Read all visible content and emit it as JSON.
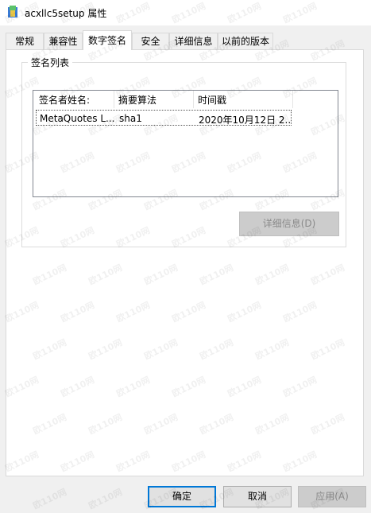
{
  "window": {
    "title": "acxllc5setup 属性"
  },
  "tabs": [
    {
      "label": "常规"
    },
    {
      "label": "兼容性"
    },
    {
      "label": "数字签名",
      "active": true
    },
    {
      "label": "安全"
    },
    {
      "label": "详细信息"
    },
    {
      "label": "以前的版本"
    }
  ],
  "signature_group": {
    "label": "签名列表",
    "columns": [
      "签名者姓名:",
      "摘要算法",
      "时间戳"
    ],
    "rows": [
      {
        "name": "MetaQuotes L...",
        "algorithm": "sha1",
        "timestamp": "2020年10月12日 2..."
      }
    ],
    "details_button": "详细信息(D)"
  },
  "footer": {
    "ok_button": "确定",
    "cancel_button": "取消",
    "apply_button": "应用(A)"
  },
  "watermark": {
    "text": "欧110网"
  },
  "colors": {
    "accent": "#0078d7",
    "window_bg": "#f0f0f0",
    "panel_bg": "#ffffff",
    "disabled_button": "#cccccc"
  }
}
